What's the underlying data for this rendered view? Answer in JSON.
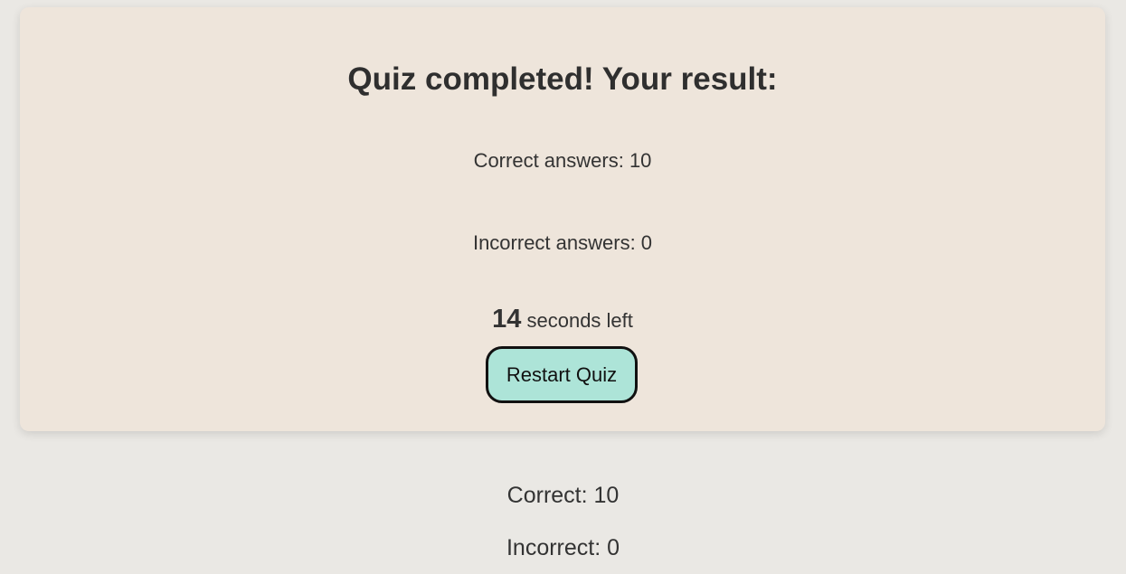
{
  "result_card": {
    "title": "Quiz completed! Your result:",
    "correct_label": "Correct answers: 10",
    "incorrect_label": "Incorrect answers: 0",
    "timer": {
      "seconds": "14",
      "suffix": " seconds left"
    },
    "restart_label": "Restart Quiz"
  },
  "summary": {
    "correct": "Correct: 10",
    "incorrect": "Incorrect: 0"
  },
  "colors": {
    "page_background": "#eae8e4",
    "card_background": "#eee5db",
    "button_background": "#ade4d8",
    "button_border": "#111111",
    "text": "#2f2f2f"
  }
}
